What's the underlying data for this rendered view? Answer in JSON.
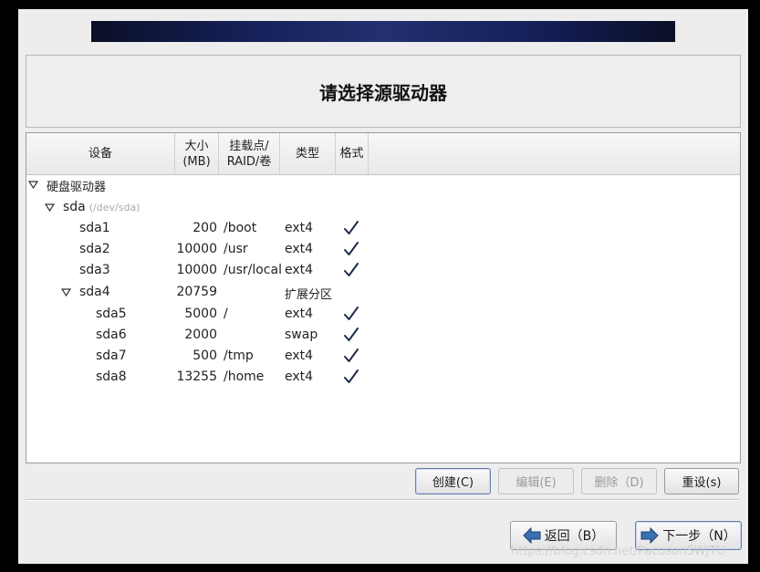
{
  "title": "请选择源驱动器",
  "columns": {
    "device": "设备",
    "size_line1": "大小",
    "size_line2": "(MB)",
    "mount_line1": "挂载点/",
    "mount_line2": "RAID/卷",
    "type": "类型",
    "format": "格式"
  },
  "tree": {
    "group_label": "硬盘驱动器",
    "disk_name": "sda",
    "disk_path": "(/dev/sda)",
    "rows": [
      {
        "name": "sda1",
        "size": "200",
        "mount": "/boot",
        "type": "ext4",
        "format": true
      },
      {
        "name": "sda2",
        "size": "10000",
        "mount": "/usr",
        "type": "ext4",
        "format": true
      },
      {
        "name": "sda3",
        "size": "10000",
        "mount": "/usr/local",
        "type": "ext4",
        "format": true
      },
      {
        "name": "sda4",
        "size": "20759",
        "mount": "",
        "type": "扩展分区",
        "format": false
      },
      {
        "name": "sda5",
        "size": "5000",
        "mount": "/",
        "type": "ext4",
        "format": true
      },
      {
        "name": "sda6",
        "size": "2000",
        "mount": "",
        "type": "swap",
        "format": true
      },
      {
        "name": "sda7",
        "size": "500",
        "mount": "/tmp",
        "type": "ext4",
        "format": true
      },
      {
        "name": "sda8",
        "size": "13255",
        "mount": "/home",
        "type": "ext4",
        "format": true
      }
    ]
  },
  "actions": {
    "create": "创建(C)",
    "edit": "编辑(E)",
    "delete": "删除（D)",
    "reset": "重设(s)"
  },
  "nav": {
    "back": "返回（B）",
    "next": "下一步（N）"
  },
  "watermark": "https://blog.csdn.net/PacosonSWJTU"
}
